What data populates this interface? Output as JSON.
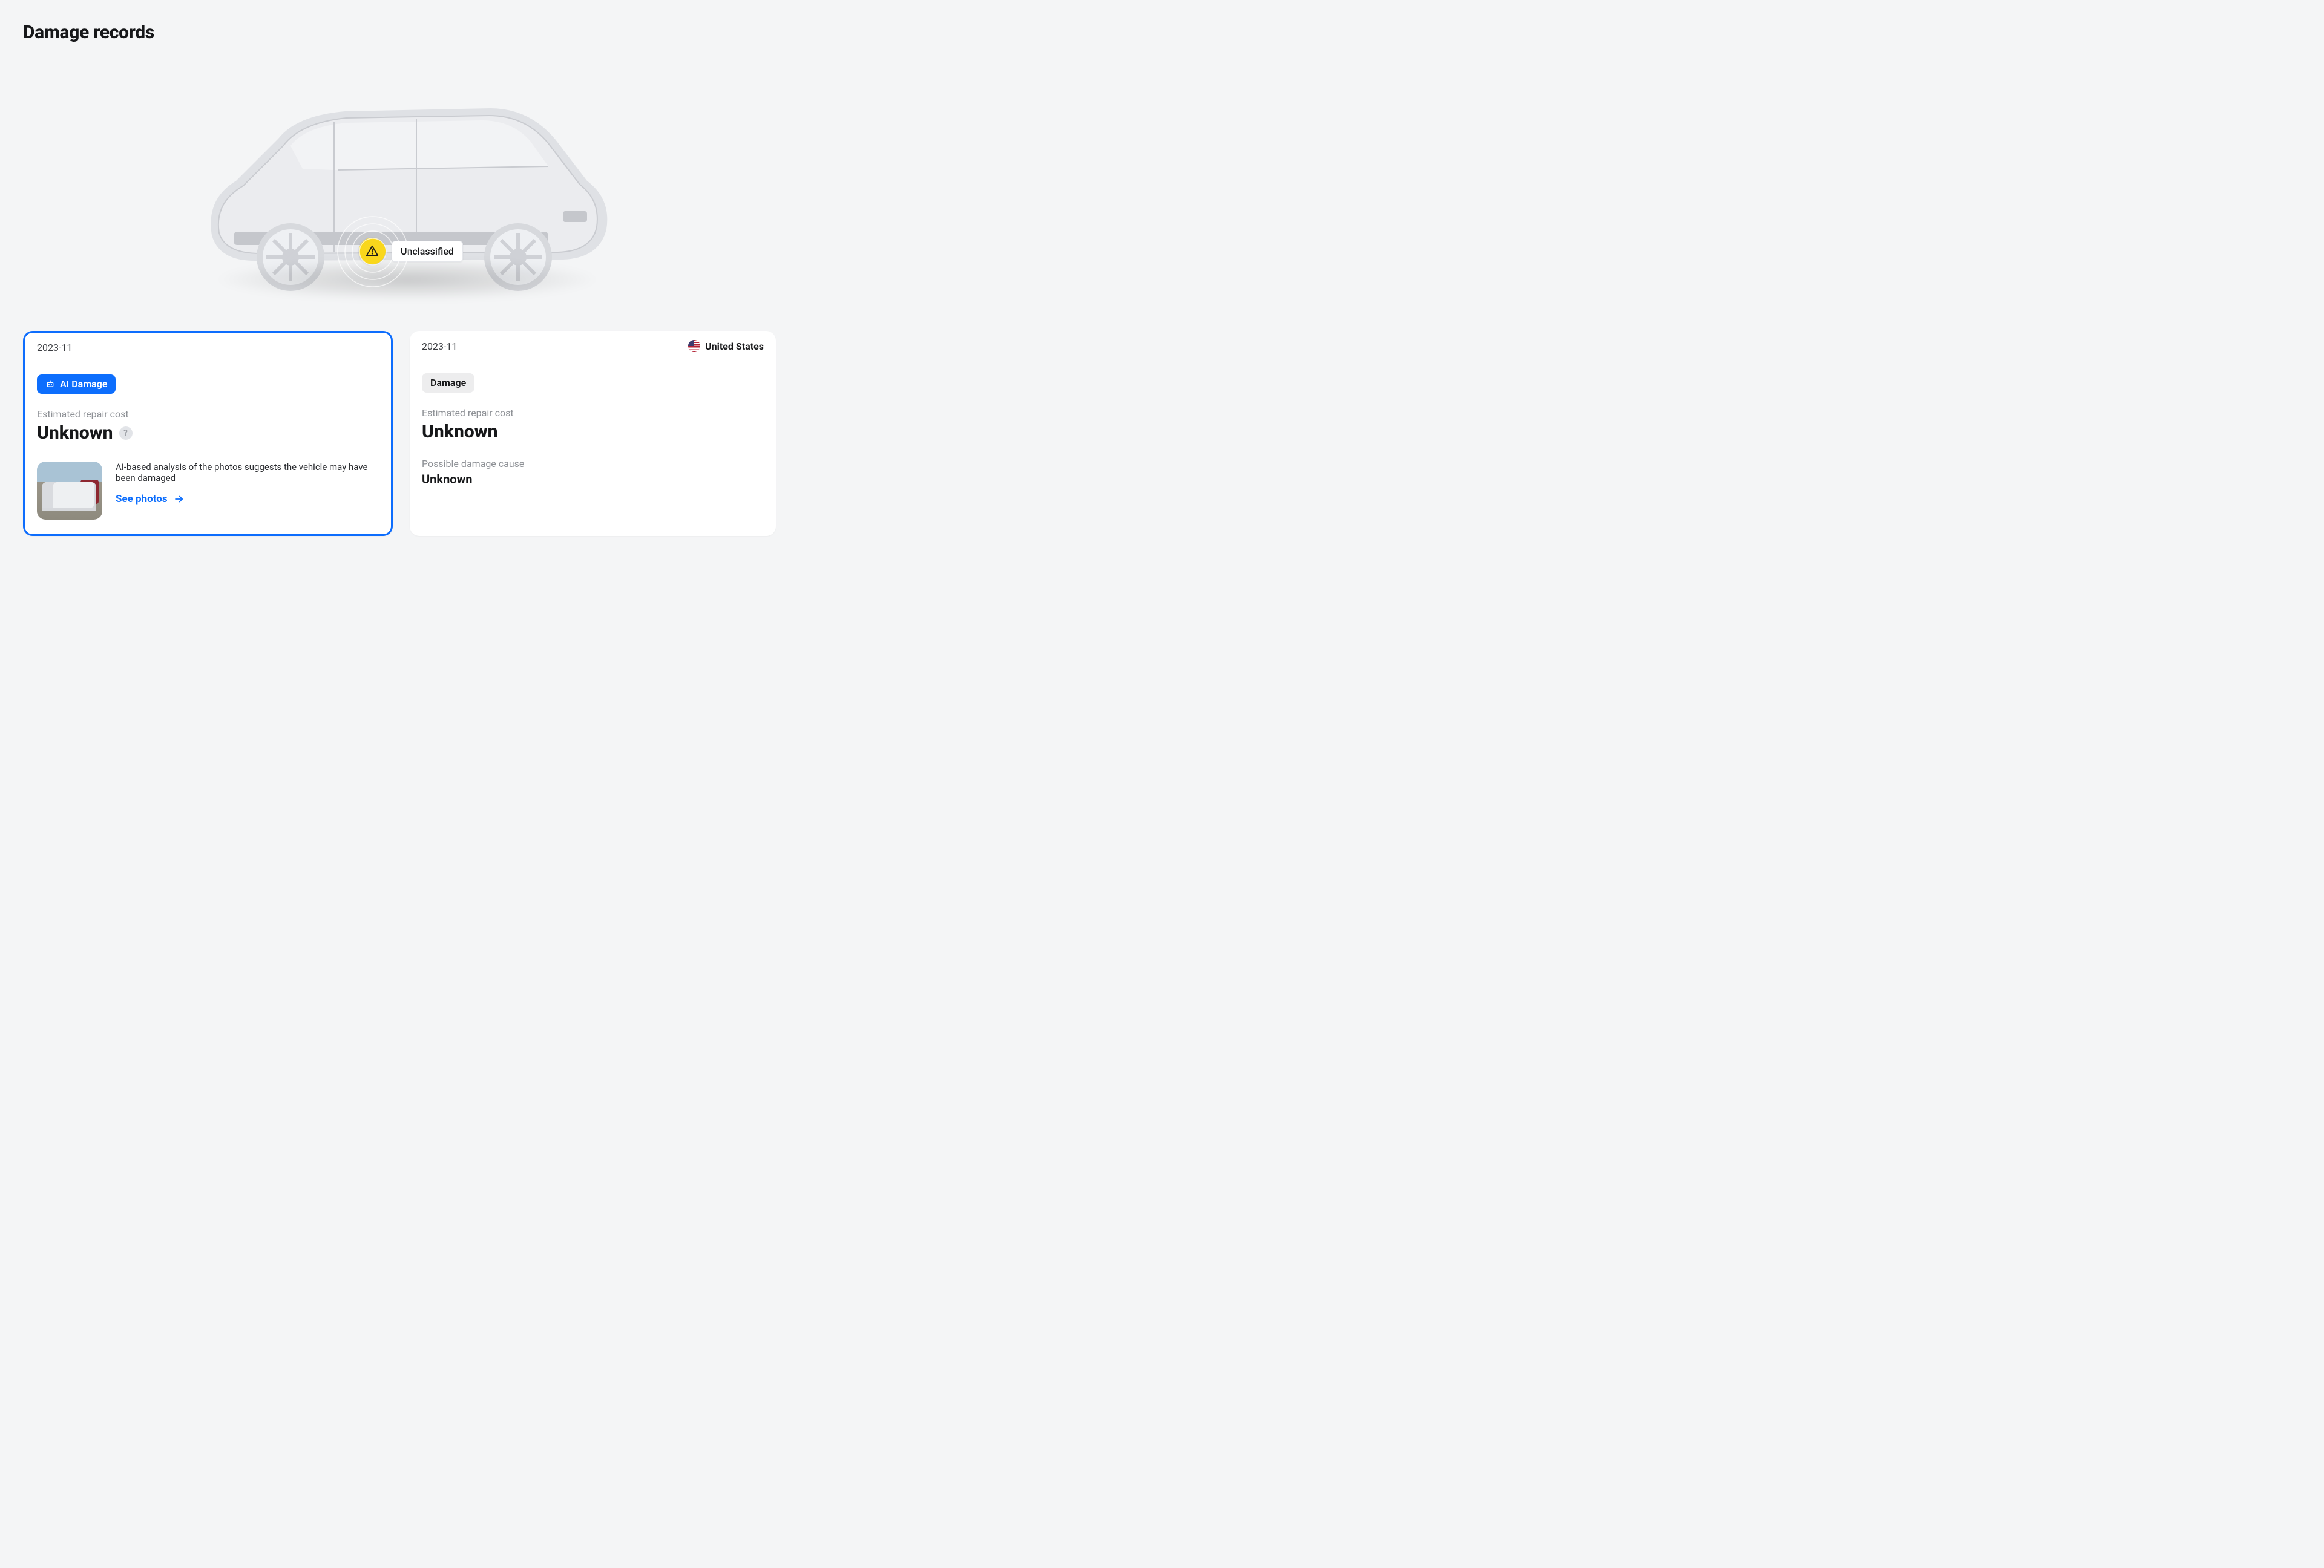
{
  "page": {
    "title": "Damage records"
  },
  "hero": {
    "marker_label": "Unclassified"
  },
  "cards": [
    {
      "date": "2023-11",
      "tag": "AI Damage",
      "cost_label": "Estimated repair cost",
      "cost_value": "Unknown",
      "ai_description": "AI-based analysis of the photos suggests the vehicle may have been damaged",
      "see_photos_label": "See photos"
    },
    {
      "date": "2023-11",
      "location": "United States",
      "tag": "Damage",
      "cost_label": "Estimated repair cost",
      "cost_value": "Unknown",
      "cause_label": "Possible damage cause",
      "cause_value": "Unknown"
    }
  ]
}
